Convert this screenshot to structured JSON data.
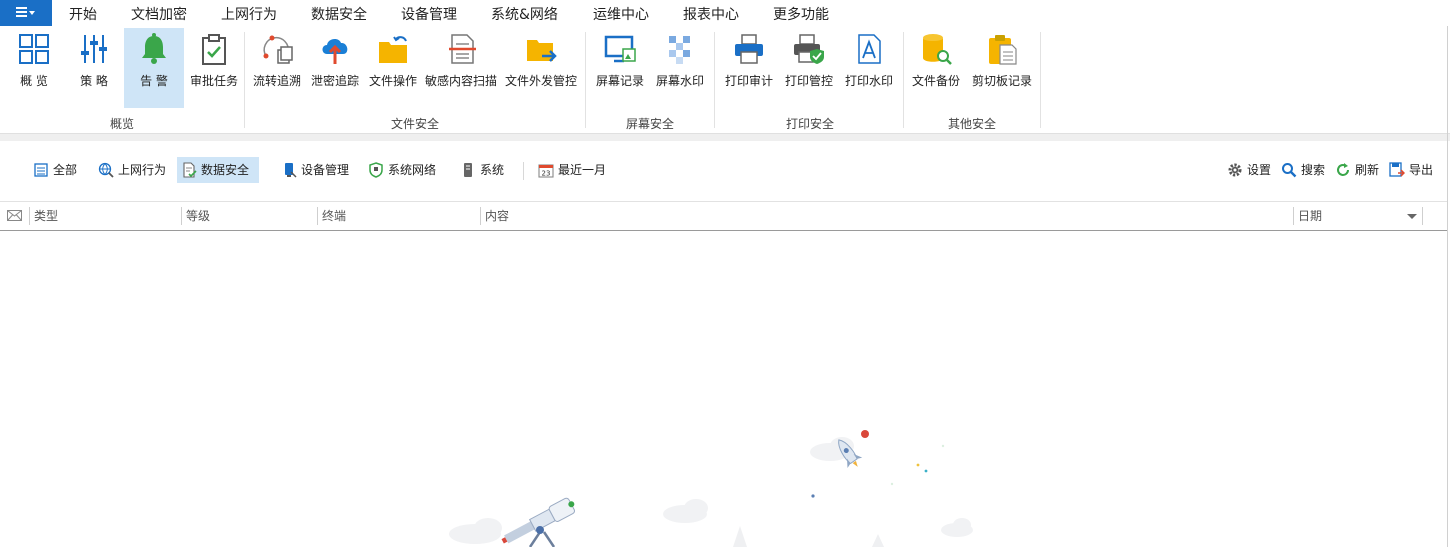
{
  "menu": {
    "items": [
      "开始",
      "文档加密",
      "上网行为",
      "数据安全",
      "设备管理",
      "系统&网络",
      "运维中心",
      "报表中心",
      "更多功能"
    ],
    "active": "数据安全"
  },
  "ribbon": {
    "groups": {
      "overview": {
        "label": "概览",
        "buttons": [
          "概 览",
          "策 略",
          "告 警",
          "审批任务"
        ]
      },
      "file_security": {
        "label": "文件安全",
        "buttons": [
          "流转追溯",
          "泄密追踪",
          "文件操作",
          "敏感内容扫描",
          "文件外发管控"
        ]
      },
      "screen_security": {
        "label": "屏幕安全",
        "buttons": [
          "屏幕记录",
          "屏幕水印"
        ]
      },
      "print_security": {
        "label": "打印安全",
        "buttons": [
          "打印审计",
          "打印管控",
          "打印水印"
        ]
      },
      "other_security": {
        "label": "其他安全",
        "buttons": [
          "文件备份",
          "剪切板记录"
        ]
      }
    },
    "selected_button": "告 警"
  },
  "filters": {
    "left": [
      "全部",
      "上网行为",
      "数据安全",
      "设备管理",
      "系统网络",
      "系统",
      "最近一月"
    ],
    "selected": "数据安全",
    "right": [
      "设置",
      "搜索",
      "刷新",
      "导出"
    ]
  },
  "table": {
    "columns": [
      "类型",
      "等级",
      "终端",
      "内容",
      "日期"
    ]
  },
  "colors": {
    "accent": "#1a6fc6",
    "selected_bg": "#cfe5f7",
    "bell_green": "#3aa64a",
    "folder_yellow": "#f5b400"
  }
}
